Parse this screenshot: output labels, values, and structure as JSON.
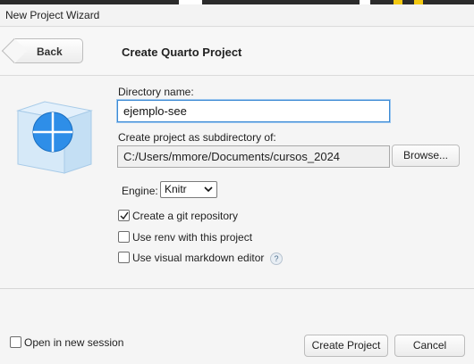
{
  "window": {
    "title": "New Project Wizard"
  },
  "header": {
    "back_label": "Back",
    "wizard_title": "Create Quarto Project"
  },
  "form": {
    "directory_label": "Directory name:",
    "directory_value": "ejemplo-see",
    "subdir_label": "Create project as subdirectory of:",
    "subdir_value": "C:/Users/mmore/Documents/cursos_2024",
    "browse_label": "Browse...",
    "engine_label": "Engine:",
    "engine_value": "Knitr",
    "options": [
      {
        "label": "Create a git repository",
        "checked": true
      },
      {
        "label": "Use renv with this project",
        "checked": false
      },
      {
        "label": "Use visual markdown editor",
        "checked": false
      }
    ],
    "help_glyph": "?"
  },
  "footer": {
    "new_session_label": "Open in new session",
    "new_session_checked": false,
    "create_label": "Create Project",
    "cancel_label": "Cancel"
  },
  "colors": {
    "focus_border": "#3c8ad4",
    "cube_blue": "#2e8ee8"
  }
}
